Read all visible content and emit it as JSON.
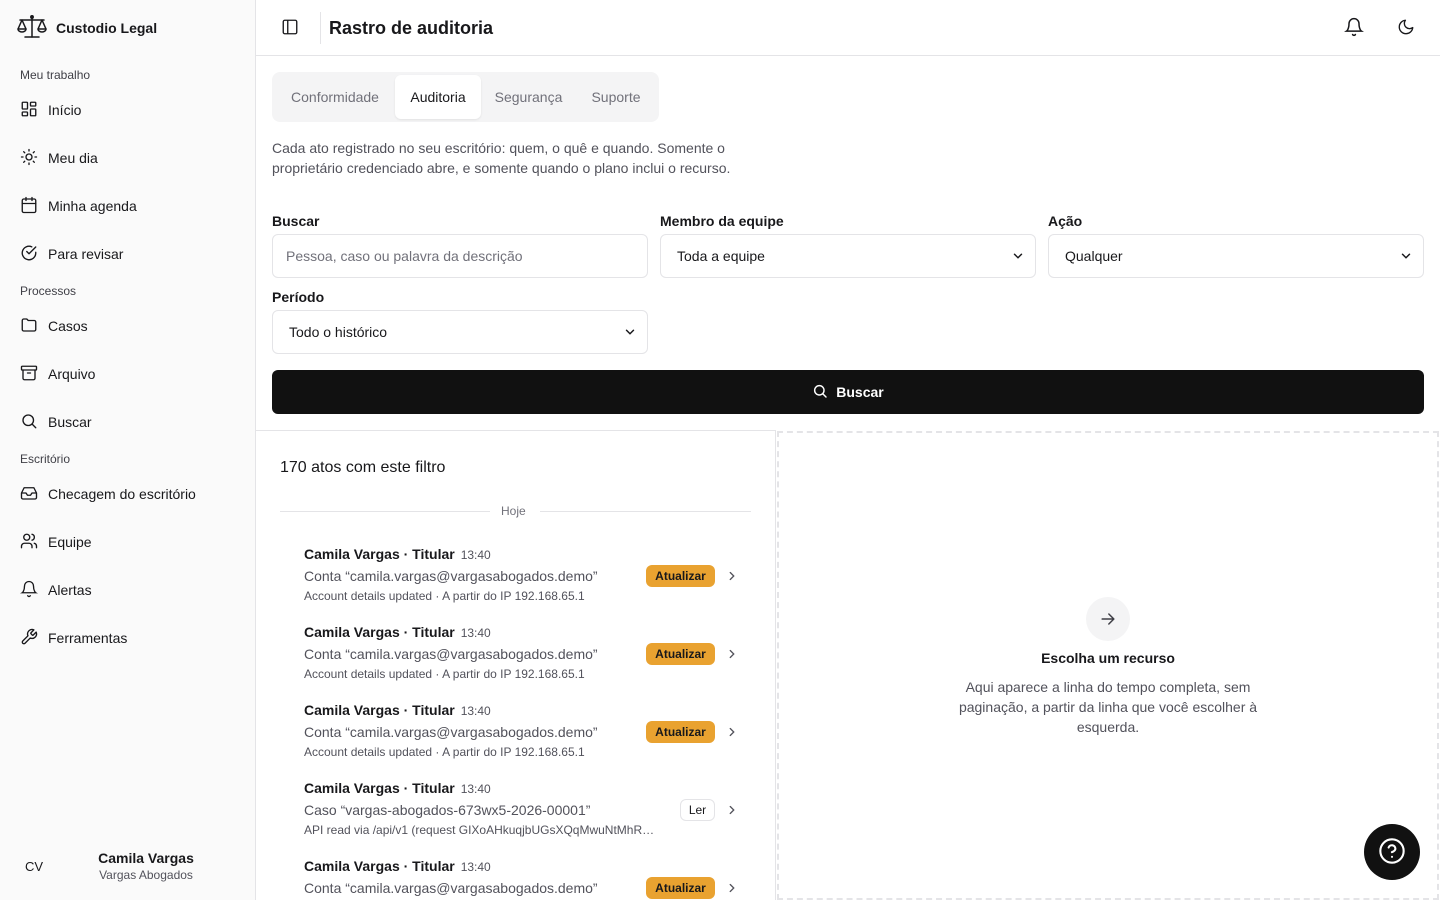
{
  "app": {
    "brand": "Custodio Legal"
  },
  "sidebar": {
    "sections": [
      "Meu trabalho",
      "Processos",
      "Escritório"
    ],
    "items": [
      {
        "label": "Início",
        "icon": "grid-icon"
      },
      {
        "label": "Meu dia",
        "icon": "sun-icon"
      },
      {
        "label": "Minha agenda",
        "icon": "calendar-icon"
      },
      {
        "label": "Para revisar",
        "icon": "check-circle-icon"
      },
      {
        "label": "Casos",
        "icon": "folder-icon"
      },
      {
        "label": "Arquivo",
        "icon": "archive-icon"
      },
      {
        "label": "Buscar",
        "icon": "search-icon"
      },
      {
        "label": "Checagem do escritório",
        "icon": "inbox-icon"
      },
      {
        "label": "Equipe",
        "icon": "users-icon"
      },
      {
        "label": "Alertas",
        "icon": "bell-icon"
      },
      {
        "label": "Ferramentas",
        "icon": "wrench-icon"
      }
    ],
    "user": {
      "initials": "CV",
      "name": "Camila Vargas",
      "firm": "Vargas Abogados"
    }
  },
  "header": {
    "title": "Rastro de auditoria"
  },
  "tabs": [
    {
      "label": "Conformidade",
      "active": false
    },
    {
      "label": "Auditoria",
      "active": true
    },
    {
      "label": "Segurança",
      "active": false
    },
    {
      "label": "Suporte",
      "active": false
    }
  ],
  "description": "Cada ato registrado no seu escritório: quem, o quê e quando. Somente o proprietário credenciado abre, e somente quando o plano inclui o recurso.",
  "filters": {
    "search": {
      "label": "Buscar",
      "placeholder": "Pessoa, caso ou palavra da descrição"
    },
    "member": {
      "label": "Membro da equipe",
      "value": "Toda a equipe"
    },
    "action": {
      "label": "Ação",
      "value": "Qualquer"
    },
    "period": {
      "label": "Período",
      "value": "Todo o histórico"
    },
    "submit_label": "Buscar"
  },
  "results": {
    "count_text": "170 atos com este filtro",
    "day_label": "Hoje",
    "entries": [
      {
        "actor": "Camila Vargas · Titular",
        "time": "13:40",
        "target": "Conta “camila.vargas@vargasabogados.demo”",
        "detail": "Account details updated · A partir do IP 192.168.65.1",
        "action": "Atualizar",
        "kind": "update"
      },
      {
        "actor": "Camila Vargas · Titular",
        "time": "13:40",
        "target": "Conta “camila.vargas@vargasabogados.demo”",
        "detail": "Account details updated · A partir do IP 192.168.65.1",
        "action": "Atualizar",
        "kind": "update"
      },
      {
        "actor": "Camila Vargas · Titular",
        "time": "13:40",
        "target": "Conta “camila.vargas@vargasabogados.demo”",
        "detail": "Account details updated · A partir do IP 192.168.65.1",
        "action": "Atualizar",
        "kind": "update"
      },
      {
        "actor": "Camila Vargas · Titular",
        "time": "13:40",
        "target": "Caso “vargas-abogados-673wx5-2026-00001”",
        "detail": "API read via /api/v1 (request GIXoAHkuqjbUGsXQqMwuNtMhR…",
        "action": "Ler",
        "kind": "read"
      },
      {
        "actor": "Camila Vargas · Titular",
        "time": "13:40",
        "target": "Conta “camila.vargas@vargasabogados.demo”",
        "detail": "",
        "action": "Atualizar",
        "kind": "update"
      }
    ]
  },
  "detail_panel": {
    "title": "Escolha um recurso",
    "text": "Aqui aparece a linha do tempo completa, sem paginação, a partir da linha que você escolher à esquerda."
  },
  "colors": {
    "accent_update": "#e9a230",
    "primary_button": "#111111"
  }
}
